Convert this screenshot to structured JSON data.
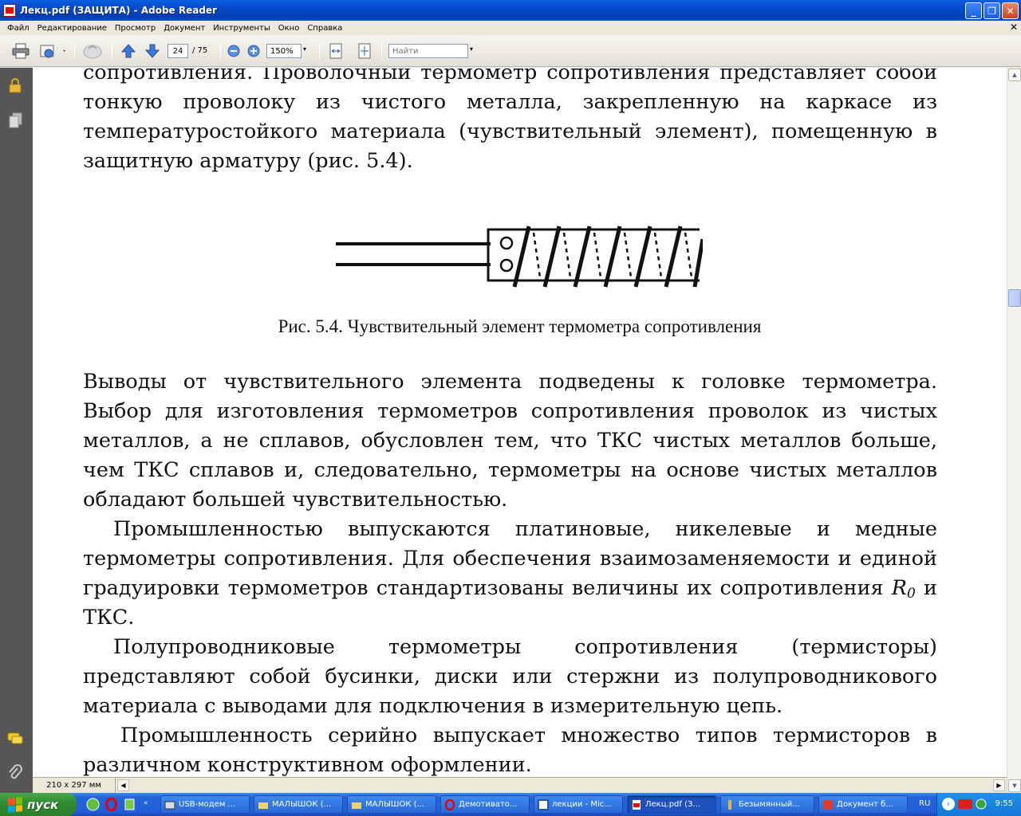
{
  "window": {
    "title": "Лекц.pdf (ЗАЩИТА) - Adobe Reader",
    "min_glyph": "_",
    "max_glyph": "❐",
    "close_glyph": "✕"
  },
  "menu": {
    "items": [
      "Файл",
      "Редактирование",
      "Просмотр",
      "Документ",
      "Инструменты",
      "Окно",
      "Справка"
    ],
    "close_glyph": "✕"
  },
  "toolbar": {
    "page_current": "24",
    "page_total": "/ 75",
    "zoom": "150%",
    "find_placeholder": "Найти",
    "dropdown_glyph": "▾"
  },
  "document": {
    "para1": [
      "сопротивления. Проволочный термометр сопротивления представляет собой",
      "тонкую проволоку из чистого металла, закрепленную на каркасе из",
      "температуростойкого материала (чувствительный элемент), помещенную в",
      "защитную арматуру (рис. 5.4)."
    ],
    "figure_caption": "Рис. 5.4. Чувствительный элемент термометра сопротивления",
    "para2": [
      "Выводы от чувствительного элемента подведены к головке термометра.",
      "Выбор для изготовления термометров сопротивления проволок из чистых",
      "металлов, а не сплавов, обусловлен тем, что ТКС чистых металлов больше,",
      "чем ТКС сплавов и, следовательно, термометры на основе чистых металлов",
      "обладают большей чувствительностью."
    ],
    "para3": [
      "Промышленностью выпускаются платиновые, никелевые и медные",
      "термометры сопротивления. Для обеспечения взаимозаменяемости и единой",
      "градуировки термометров стандартизованы величины их сопротивления",
      "ТКС."
    ],
    "r0_symbol": "R",
    "r0_subscript": "0",
    "r0_after": " и",
    "para4": [
      "Полупроводниковые термометры сопротивления (термисторы)",
      "представляют собой бусинки, диски или стержни из полупроводникового",
      "материала с выводами для подключения в измерительную цепь."
    ],
    "para5": [
      "Промышленность серийно выпускает множество типов термисторов в",
      "различном конструктивном оформлении."
    ]
  },
  "status": {
    "page_size": "210 x 297 мм"
  },
  "taskbar": {
    "start_label": "пуск",
    "tasks": [
      "USB-модем ...",
      "МАЛЫШОК (...",
      "МАЛЫШОК (...",
      "Демотивато...",
      "лекции - Mic...",
      "Лекц.pdf (З...",
      "Безымянный...",
      "Документ б..."
    ],
    "language": "RU",
    "clock": "9:55"
  },
  "colors": {
    "title_bar": "#0548c6",
    "nav_pane": "#565656",
    "menu_bg": "#ece9d8",
    "taskbar": "#245edb",
    "start_button": "#318d31"
  },
  "icons": {
    "toolbar": [
      "print-icon",
      "email-icon",
      "hand-icon",
      "prev-page-icon",
      "next-page-icon",
      "zoom-out-icon",
      "zoom-in-icon",
      "fit-width-icon",
      "fit-page-icon"
    ],
    "nav": [
      "lock-icon",
      "pages-icon",
      "comments-icon",
      "attachment-icon"
    ]
  }
}
